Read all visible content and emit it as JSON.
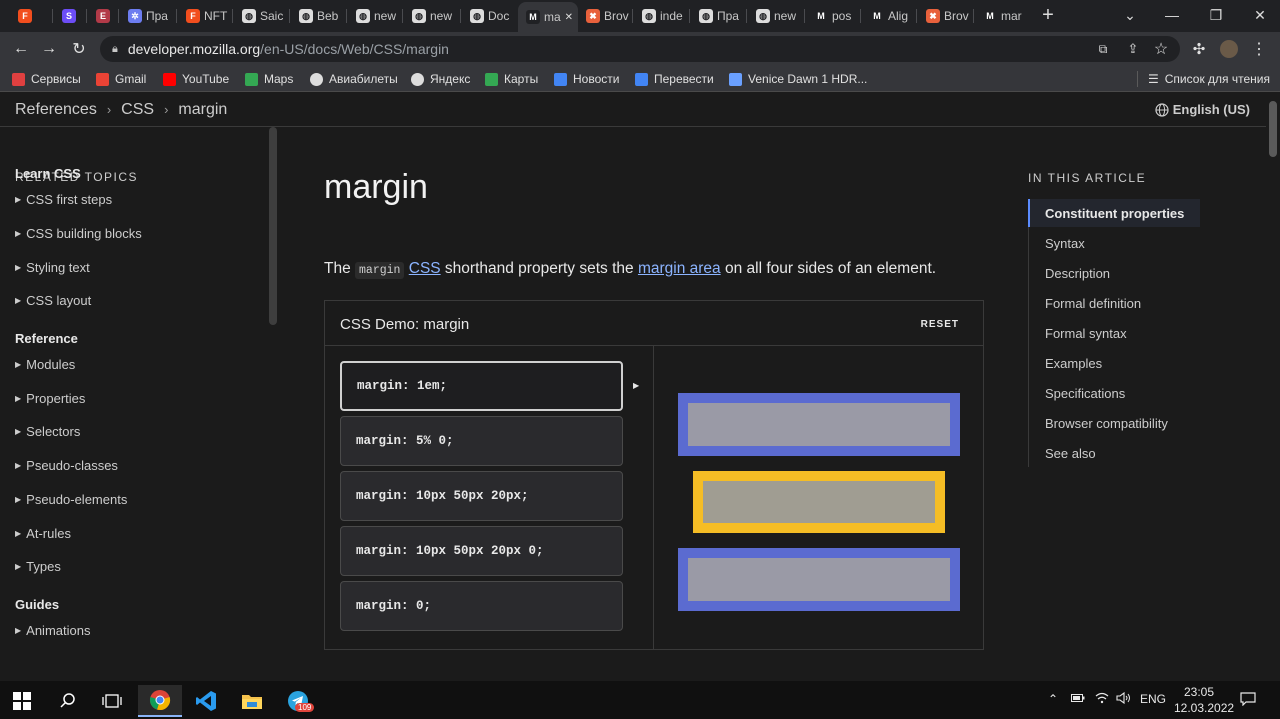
{
  "browser": {
    "tabs": [
      {
        "label": "",
        "color": "#f24e1e",
        "glyph": "F"
      },
      {
        "label": "",
        "color": "#6c4df6",
        "glyph": "S"
      },
      {
        "label": "",
        "color": "#b23a48",
        "glyph": "E"
      },
      {
        "label": "Пра",
        "color": "#6d7df0",
        "glyph": "✲"
      },
      {
        "label": "NFT",
        "color": "#f24e1e",
        "glyph": "F"
      },
      {
        "label": "Saic",
        "color": "#dddddd",
        "glyph": "◍"
      },
      {
        "label": "Beb",
        "color": "#dddddd",
        "glyph": "◍"
      },
      {
        "label": "new",
        "color": "#dddddd",
        "glyph": "◍"
      },
      {
        "label": "new",
        "color": "#dddddd",
        "glyph": "◍"
      },
      {
        "label": "Doc",
        "color": "#dddddd",
        "glyph": "◍"
      },
      {
        "label": "ma",
        "color": "#e8e8e8",
        "glyph": "M"
      },
      {
        "label": "Brov",
        "color": "#e8613c",
        "glyph": "✖"
      },
      {
        "label": "inde",
        "color": "#dddddd",
        "glyph": "◍"
      },
      {
        "label": "Пра",
        "color": "#dddddd",
        "glyph": "◍"
      },
      {
        "label": "new",
        "color": "#dddddd",
        "glyph": "◍"
      },
      {
        "label": "pos",
        "color": "#e8e8e8",
        "glyph": "M"
      },
      {
        "label": "Alig",
        "color": "#e8e8e8",
        "glyph": "M"
      },
      {
        "label": "Brov",
        "color": "#e8613c",
        "glyph": "✖"
      },
      {
        "label": "mar",
        "color": "#e8e8e8",
        "glyph": "M"
      }
    ],
    "active_tab_index": 10,
    "new_tab_label": "+",
    "window_controls": {
      "collapse": "⌄",
      "minimize": "—",
      "restore": "❐",
      "close": "✕"
    },
    "url_host": "developer.mozilla.org",
    "url_path": "/en-US/docs/Web/CSS/margin",
    "bookmarks": [
      {
        "label": "Сервисы",
        "icon": "apps-grid-icon",
        "color": "#e04040"
      },
      {
        "label": "Gmail",
        "icon": "gmail-icon",
        "color": "#ea4335"
      },
      {
        "label": "YouTube",
        "icon": "youtube-icon",
        "color": "#ff0000"
      },
      {
        "label": "Maps",
        "icon": "maps-icon",
        "color": "#34a853"
      },
      {
        "label": "Авиабилеты",
        "icon": "globe-icon",
        "color": "#dddddd"
      },
      {
        "label": "Яндекс",
        "icon": "globe-icon",
        "color": "#dddddd"
      },
      {
        "label": "Карты",
        "icon": "maps-icon",
        "color": "#34a853"
      },
      {
        "label": "Новости",
        "icon": "news-icon",
        "color": "#4285f4"
      },
      {
        "label": "Перевести",
        "icon": "translate-icon",
        "color": "#4285f4"
      },
      {
        "label": "Venice Dawn 1 HDR...",
        "icon": "page-icon",
        "color": "#6aa0ff"
      }
    ],
    "reading_list_label": "Список для чтения"
  },
  "page": {
    "breadcrumbs": [
      "References",
      "CSS",
      "margin"
    ],
    "breadcrumb_sep": "›",
    "language": "English (US)",
    "sidebar": {
      "heading": "RELATED TOPICS",
      "groups": [
        {
          "title": "Learn CSS",
          "items": [
            "CSS first steps",
            "CSS building blocks",
            "Styling text",
            "CSS layout"
          ]
        },
        {
          "title": "Reference",
          "items": [
            "Modules",
            "Properties",
            "Selectors",
            "Pseudo-classes",
            "Pseudo-elements",
            "At-rules",
            "Types"
          ]
        },
        {
          "title": "Guides",
          "items": [
            "Animations"
          ]
        }
      ]
    },
    "title": "margin",
    "intro": {
      "before": "The ",
      "code": "margin",
      "link1": "CSS",
      "middle": " shorthand property sets the ",
      "link2": "margin area",
      "after": " on all four sides of an element."
    },
    "demo": {
      "title": "CSS Demo: margin",
      "reset": "RESET",
      "options": [
        "margin: 1em;",
        "margin: 5% 0;",
        "margin: 10px 50px 20px;",
        "margin: 10px 50px 20px 0;",
        "margin: 0;"
      ],
      "selected_index": 0,
      "colors": {
        "blue_border": "#5b6bd0",
        "blue_fill": "#9a9aa6",
        "yellow_border": "#f5bd25",
        "yellow_fill": "#a09d92"
      }
    },
    "toc": {
      "heading": "IN THIS ARTICLE",
      "items": [
        "Constituent properties",
        "Syntax",
        "Description",
        "Formal definition",
        "Formal syntax",
        "Examples",
        "Specifications",
        "Browser compatibility",
        "See also"
      ],
      "active_index": 0
    }
  },
  "taskbar": {
    "apps": [
      "windows-start-icon",
      "search-icon",
      "task-view-icon",
      "chrome-icon",
      "vscode-icon",
      "file-explorer-icon",
      "telegram-icon"
    ],
    "telegram_badge": "109",
    "language": "ENG",
    "time": "23:05",
    "date": "12.03.2022"
  }
}
